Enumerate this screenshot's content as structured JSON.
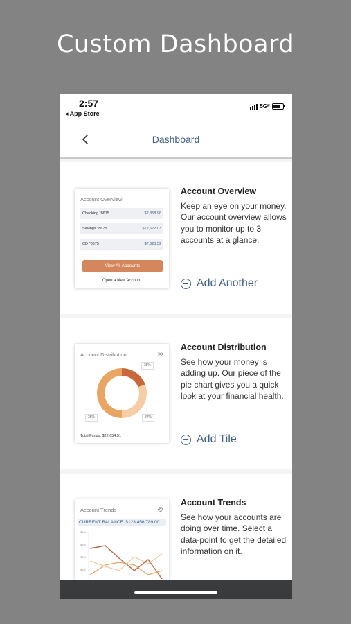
{
  "promo": {
    "title": "Custom Dashboard"
  },
  "status_bar": {
    "time": "2:57",
    "back_app": "◂ App Store",
    "network": "5G",
    "network_suffix": "E"
  },
  "nav": {
    "title": "Dashboard",
    "back_icon": "chevron-left-icon"
  },
  "tiles": [
    {
      "preview": {
        "title": "Account Overview",
        "accounts": [
          {
            "name": "Checking *8675",
            "amount": "$2,358.96"
          },
          {
            "name": "Savings *8675",
            "amount": "$12,672.03"
          },
          {
            "name": "CD *8675",
            "amount": "$7,623.52"
          }
        ],
        "button": "View All Accounts",
        "link": "Open a New Account"
      },
      "title": "Account Overview",
      "description": "Keep an eye on your money. Our account overview allows you to monitor up to 3 accounts at a glance.",
      "action": "Add Another"
    },
    {
      "preview": {
        "title": "Account Distribution",
        "percents": [
          "38%",
          "35%",
          "37%"
        ],
        "total": "Total Funds: $22,654.51",
        "colors": [
          "#c9683a",
          "#e9a563",
          "#f6cda5"
        ]
      },
      "title": "Account Distribution",
      "description": "See how your money is adding up. Our piece of the pie chart gives you a quick look at your financial health.",
      "action": "Add Tile"
    },
    {
      "preview": {
        "title": "Account Trends",
        "balance": "CURRENT BALANCE: $123,456,789.00",
        "y_ticks": [
          "$4M",
          "$3M",
          "$2M",
          "$1M"
        ]
      },
      "title": "Account Trends",
      "description": "See how your accounts are doing over time. Select a data-point to get the detailed information on it."
    }
  ]
}
